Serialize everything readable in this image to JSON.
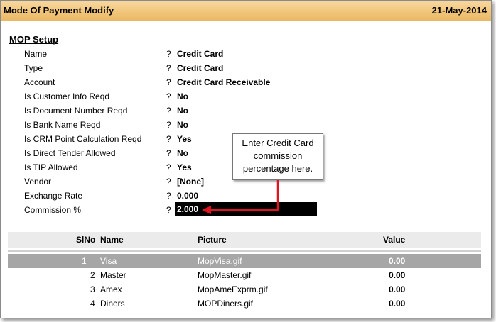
{
  "window": {
    "title": "Mode Of Payment Modify",
    "date": "21-May-2014"
  },
  "section_title": "MOP Setup",
  "fields": [
    {
      "label": "Name",
      "sep": "?",
      "value": "Credit Card"
    },
    {
      "label": "Type",
      "sep": "?",
      "value": "Credit Card"
    },
    {
      "label": "Account",
      "sep": "?",
      "value": "Credit Card Receivable"
    },
    {
      "label": "Is Customer Info Reqd",
      "sep": "?",
      "value": "No"
    },
    {
      "label": "Is Document Number Reqd",
      "sep": "?",
      "value": "No"
    },
    {
      "label": "Is Bank Name Reqd",
      "sep": "?",
      "value": "No"
    },
    {
      "label": "Is CRM Point Calculation Reqd",
      "sep": "?",
      "value": "Yes"
    },
    {
      "label": "Is Direct Tender Allowed",
      "sep": "?",
      "value": "No"
    },
    {
      "label": "Is TIP Allowed",
      "sep": "?",
      "value": "Yes"
    },
    {
      "label": "Vendor",
      "sep": "?",
      "value": "[None]"
    },
    {
      "label": "Exchange Rate",
      "sep": "?",
      "value": "0.000"
    },
    {
      "label": "Commission %",
      "sep": "?",
      "value": "2.000"
    }
  ],
  "callout": {
    "line1": "Enter Credit Card",
    "line2": "commission",
    "line3": "percentage here."
  },
  "grid": {
    "headers": {
      "slno": "SlNo",
      "name": "Name",
      "picture": "Picture",
      "value": "Value"
    },
    "rows": [
      {
        "slno": "1",
        "name": "Visa",
        "picture": "MopVisa.gif",
        "value": "0.00"
      },
      {
        "slno": "2",
        "name": "Master",
        "picture": "MopMaster.gif",
        "value": "0.00"
      },
      {
        "slno": "3",
        "name": "Amex",
        "picture": "MopAmeExprm.gif",
        "value": "0.00"
      },
      {
        "slno": "4",
        "name": "Diners",
        "picture": "MOPDiners.gif",
        "value": "0.00"
      }
    ]
  },
  "colors": {
    "titlebar": "#f1c67c",
    "arrow": "#e0141e",
    "selected_row": "#a6a6a6"
  }
}
